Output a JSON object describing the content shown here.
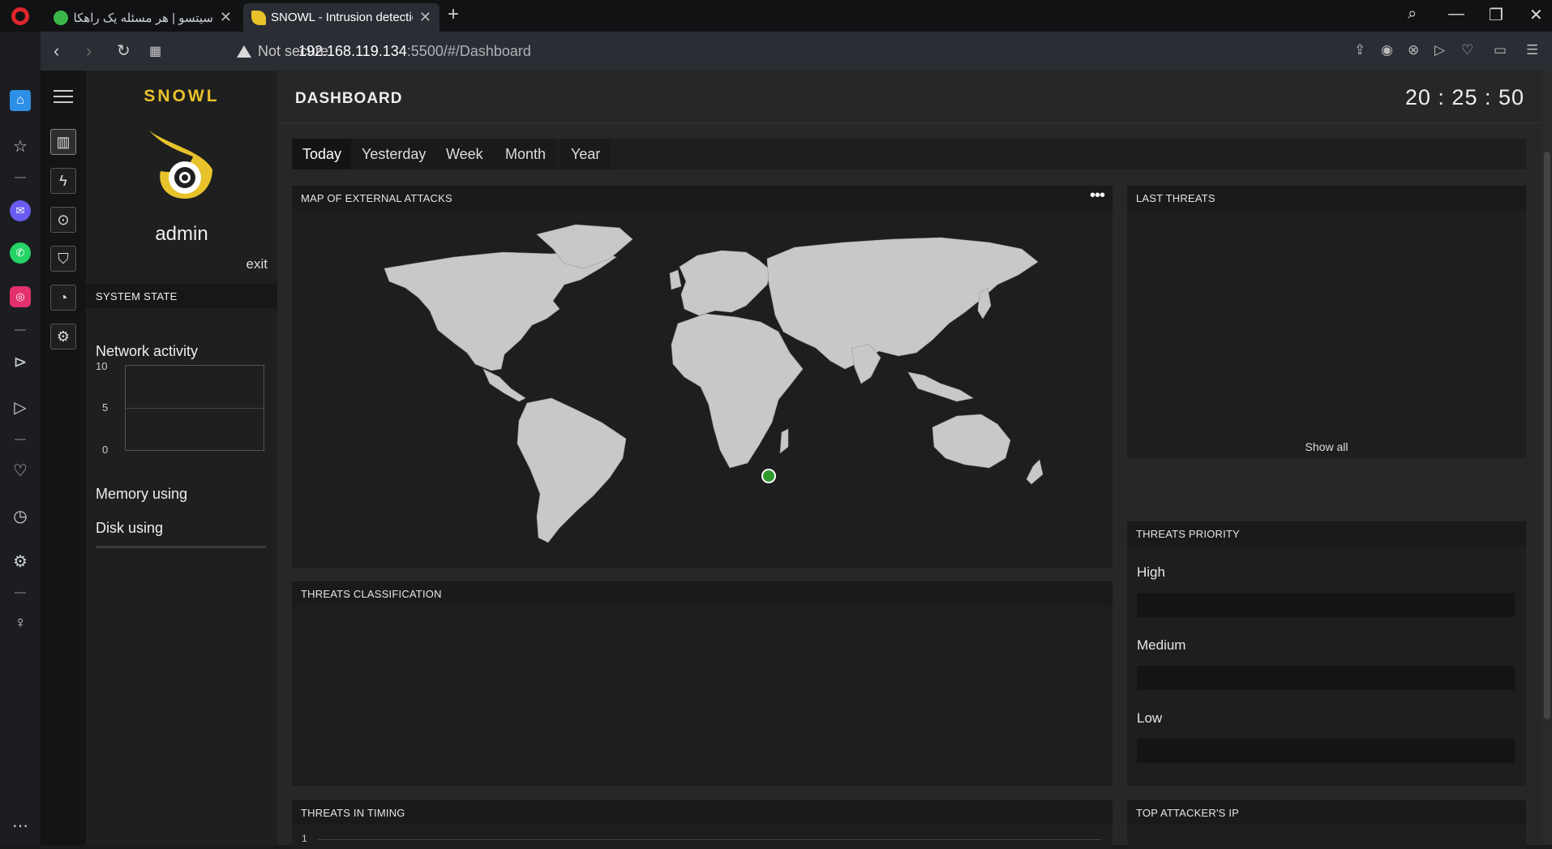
{
  "browser": {
    "tabs": [
      {
        "title": "سیتسو | هر مسئله یک راهکار",
        "favicon_color": "#3bb54a"
      },
      {
        "title": "SNOWL - Intrusion detection",
        "favicon_color": "#e8c22a"
      }
    ],
    "security_label": "Not secure",
    "url_host": "192.168.119.134",
    "url_path": ":5500/#/Dashboard"
  },
  "app": {
    "brand": "SNOWL",
    "user": "admin",
    "exit_label": "exit",
    "system_state_title": "SYSTEM STATE",
    "network_activity_label": "Network activity",
    "network_axis": [
      "10",
      "5",
      "0"
    ],
    "memory_label": "Memory using",
    "disk_label": "Disk using"
  },
  "dashboard": {
    "title": "DASHBOARD",
    "clock": "20 : 25 : 50",
    "periods": [
      "Today",
      "Yesterday",
      "Week",
      "Month",
      "Year"
    ],
    "active_period": "Today",
    "map_title": "MAP OF EXTERNAL ATTACKS",
    "last_threats_title": "LAST THREATS",
    "show_all": "Show all",
    "threats_priority_title": "THREATS PRIORITY",
    "priority_levels": [
      "High",
      "Medium",
      "Low"
    ],
    "threats_classification_title": "THREATS CLASSIFICATION",
    "threats_timing_title": "THREATS IN TIMING",
    "timing_axis_top": "1",
    "top_attacker_title": "TOP ATTACKER'S IP"
  },
  "colors": {
    "brand": "#e8c22a",
    "marker": "#2e9a2e",
    "land": "#c8c8c8"
  }
}
